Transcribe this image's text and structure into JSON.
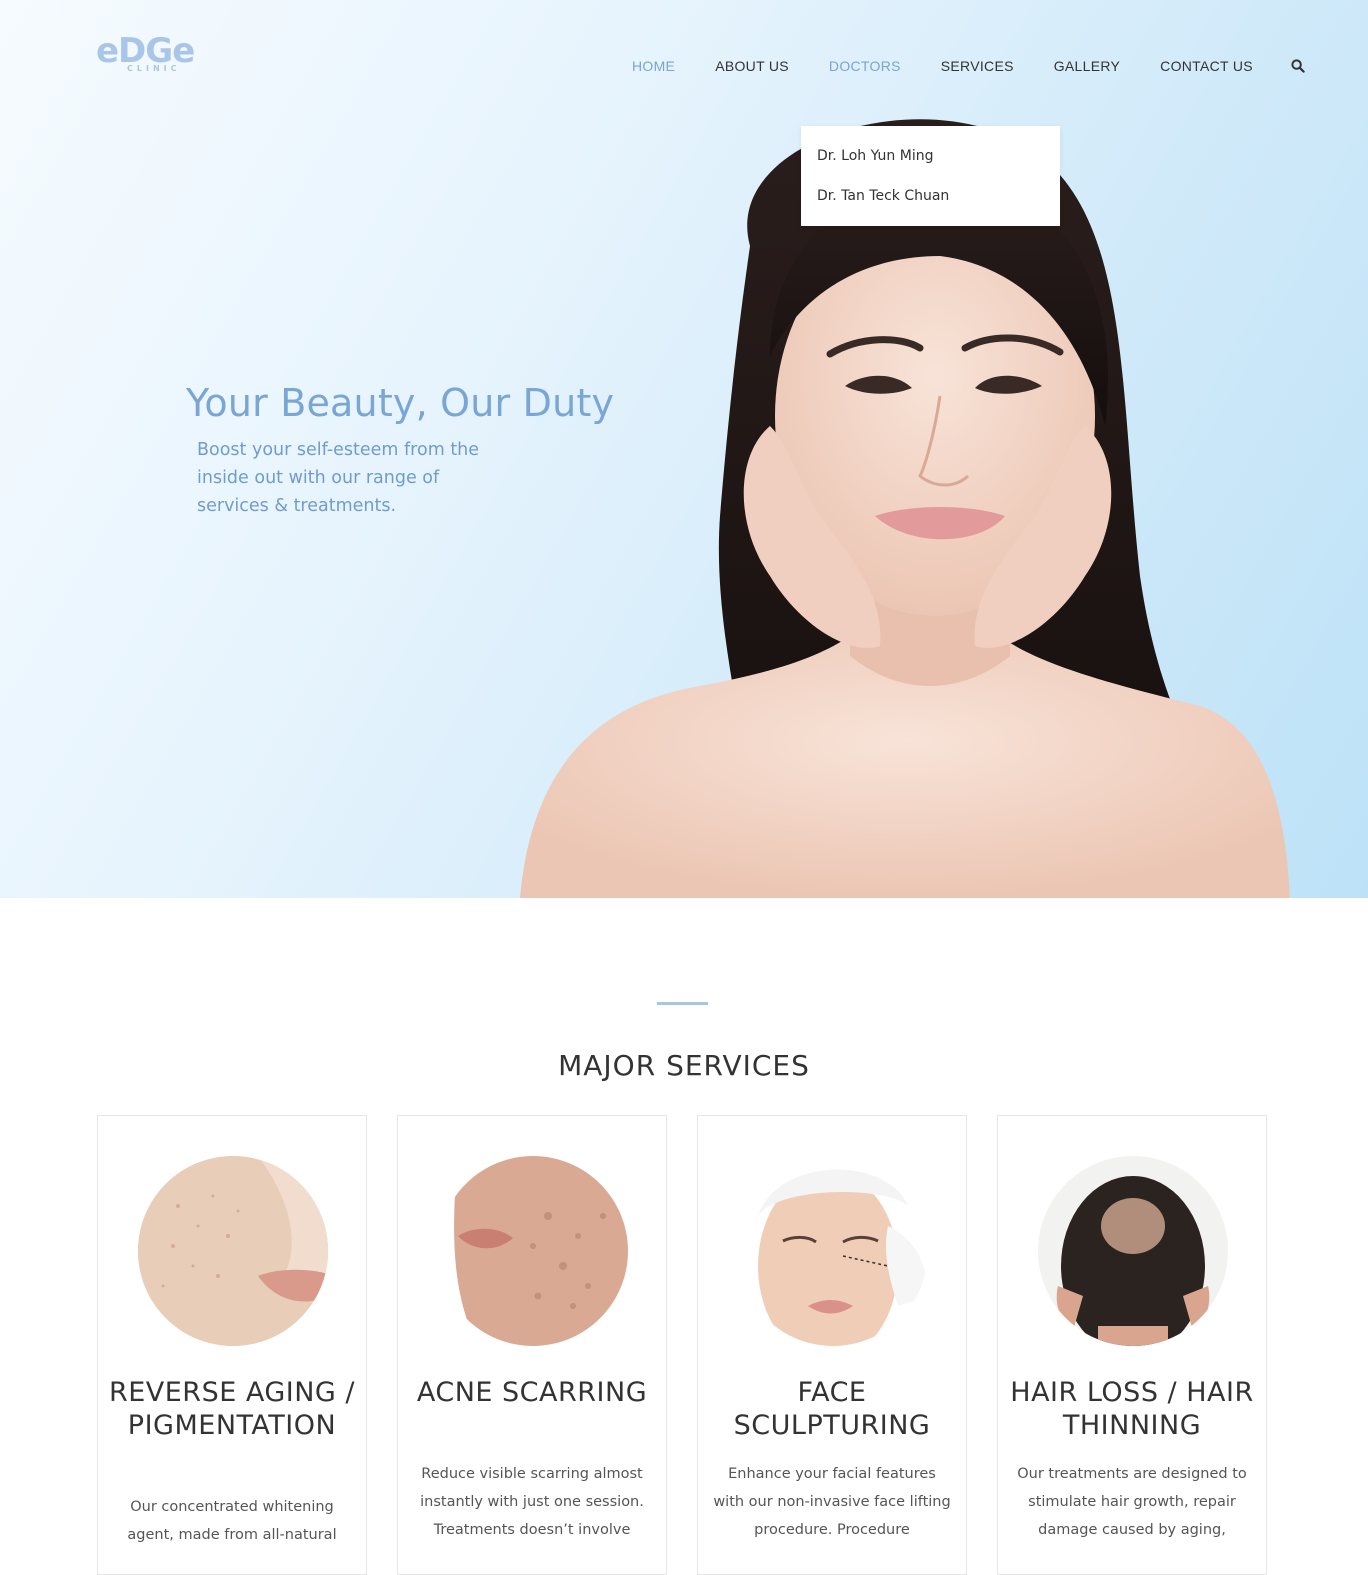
{
  "logo": {
    "word": "eDGe",
    "sub": "CLINIC"
  },
  "nav": {
    "items": [
      {
        "label": "HOME"
      },
      {
        "label": "ABOUT US"
      },
      {
        "label": "DOCTORS"
      },
      {
        "label": "SERVICES"
      },
      {
        "label": "GALLERY"
      },
      {
        "label": "CONTACT US"
      }
    ],
    "search_icon": "search-icon"
  },
  "doctors_menu": [
    "Dr. Loh Yun Ming",
    "Dr. Tan Teck Chuan"
  ],
  "hero": {
    "title": "Your Beauty, Our Duty",
    "subtitle": "Boost your self-esteem from the inside out with our range of services & treatments."
  },
  "services": {
    "heading": "MAJOR SERVICES",
    "cards": [
      {
        "title": "REVERSE AGING / PIGMENTATION",
        "desc": "Our concentrated whitening agent, made from all-natural"
      },
      {
        "title": "ACNE SCARRING",
        "desc": "Reduce visible scarring almost instantly with just one session. Treatments doesn’t involve"
      },
      {
        "title": "FACE SCULPTURING",
        "desc": "Enhance your facial features with our non-invasive face lifting procedure. Procedure"
      },
      {
        "title": "HAIR LOSS / HAIR THINNING",
        "desc": "Our treatments are designed to stimulate hair growth, repair damage caused by aging,"
      }
    ]
  },
  "colors": {
    "accent": "#7aa6cf",
    "logo": "#a9c6e8",
    "hero_text": "#7aa6d6"
  }
}
